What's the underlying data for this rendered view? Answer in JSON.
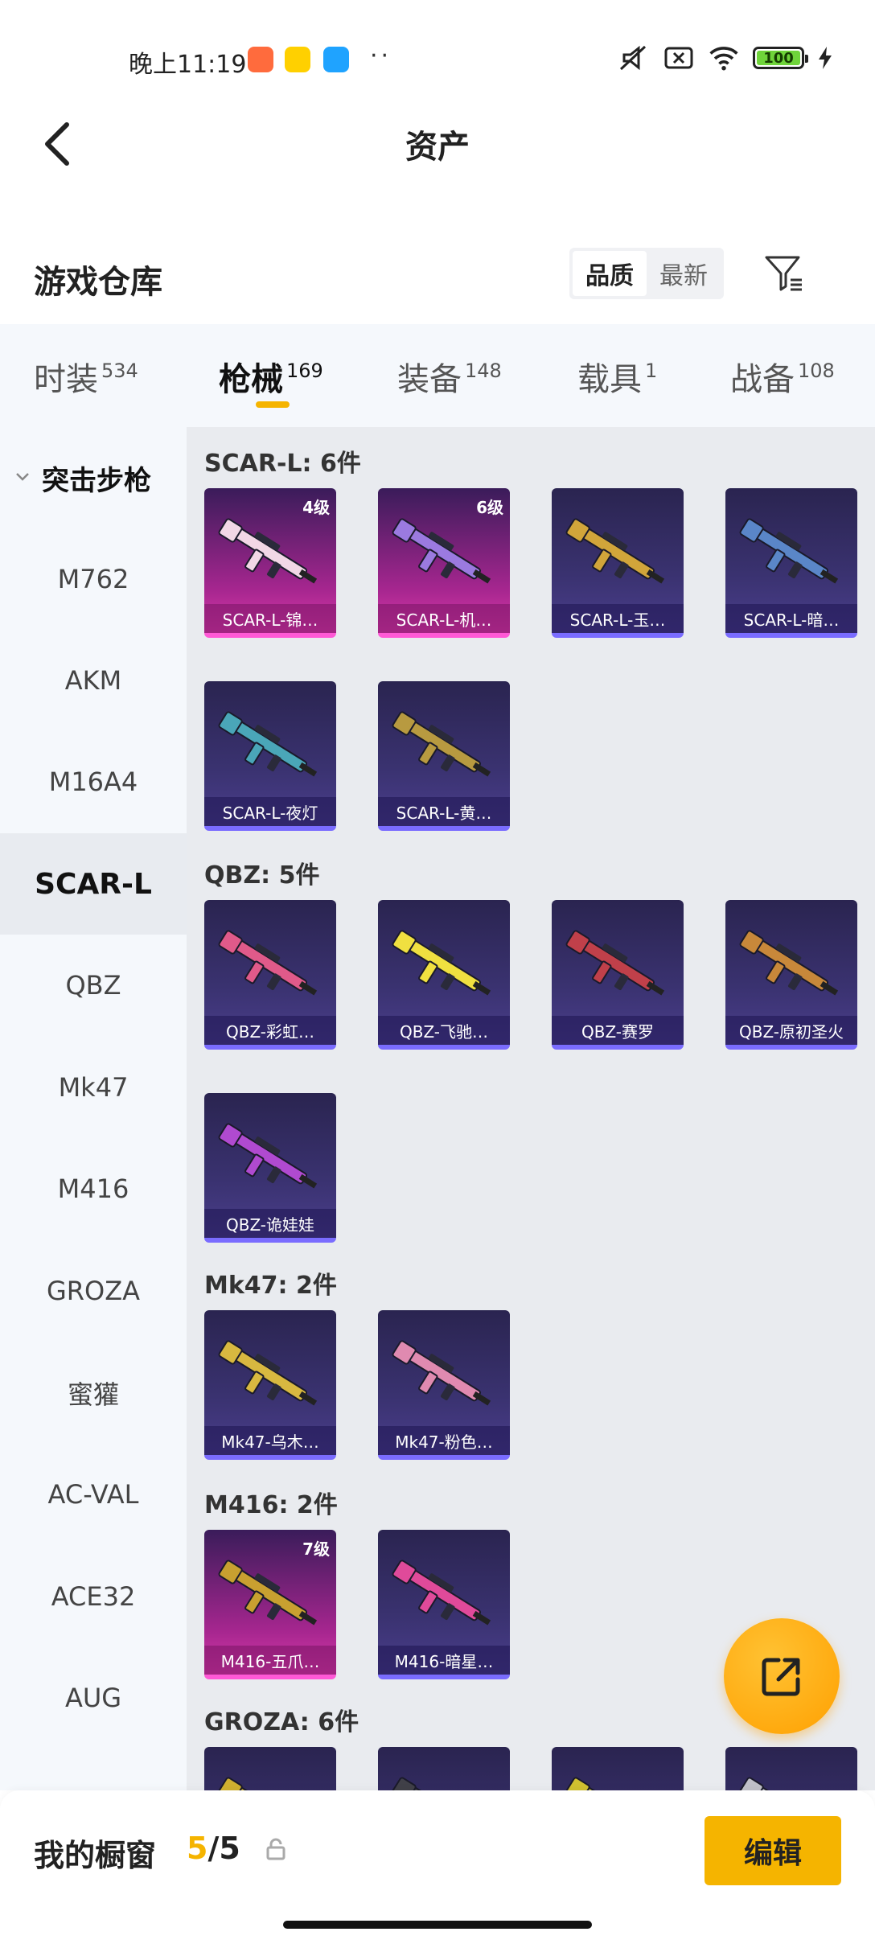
{
  "status_bar": {
    "time": "晚上11:19",
    "dots": "··",
    "battery": "100",
    "colors": {
      "app1": "#ff6b3d",
      "app2": "#ffd000",
      "app3": "#1fa3ff",
      "battery_fill": "#6fd43a"
    }
  },
  "header": {
    "title": "资产",
    "back_icon": "chevron-left-icon"
  },
  "warehouse": {
    "title": "游戏仓库",
    "sort_options": [
      "品质",
      "最新"
    ],
    "sort_selected": "品质",
    "filter_icon": "filter-icon"
  },
  "tabs": [
    {
      "label": "时装",
      "count": "534",
      "active": false
    },
    {
      "label": "枪械",
      "count": "169",
      "active": true
    },
    {
      "label": "装备",
      "count": "148",
      "active": false
    },
    {
      "label": "载具",
      "count": "1",
      "active": false
    },
    {
      "label": "战备",
      "count": "108",
      "active": false
    }
  ],
  "sidebar": {
    "group": "突击步枪",
    "items": [
      "M762",
      "AKM",
      "M16A4",
      "SCAR-L",
      "QBZ",
      "Mk47",
      "M416",
      "GROZA",
      "蜜獾",
      "AC-VAL",
      "ACE32",
      "AUG"
    ],
    "active": "SCAR-L"
  },
  "groups": [
    {
      "label": "SCAR-L: 6件",
      "items": [
        {
          "name": "SCAR-L-锦…",
          "level": "4级",
          "rarity": "purple",
          "color": "#f2d7e6"
        },
        {
          "name": "SCAR-L-机…",
          "level": "6级",
          "rarity": "purple",
          "color": "#9b7ae0"
        },
        {
          "name": "SCAR-L-玉…",
          "level": "",
          "rarity": "blue",
          "color": "#d1a53a"
        },
        {
          "name": "SCAR-L-暗…",
          "level": "",
          "rarity": "blue",
          "color": "#5a86c8"
        },
        {
          "name": "SCAR-L-夜灯",
          "level": "",
          "rarity": "blue",
          "color": "#4aa6b8"
        },
        {
          "name": "SCAR-L-黄…",
          "level": "",
          "rarity": "blue",
          "color": "#b89a40"
        }
      ]
    },
    {
      "label": "QBZ: 5件",
      "items": [
        {
          "name": "QBZ-彩虹…",
          "level": "",
          "rarity": "blue",
          "color": "#e05a8a"
        },
        {
          "name": "QBZ-飞驰…",
          "level": "",
          "rarity": "blue",
          "color": "#f0e040"
        },
        {
          "name": "QBZ-赛罗",
          "level": "",
          "rarity": "blue",
          "color": "#c0404a"
        },
        {
          "name": "QBZ-原初圣火",
          "level": "",
          "rarity": "blue",
          "color": "#c8883a"
        },
        {
          "name": "QBZ-诡娃娃",
          "level": "",
          "rarity": "blue",
          "color": "#b04ad0"
        }
      ]
    },
    {
      "label": "Mk47: 2件",
      "items": [
        {
          "name": "Mk47-乌木…",
          "level": "",
          "rarity": "blue",
          "color": "#d8b840"
        },
        {
          "name": "Mk47-粉色…",
          "level": "",
          "rarity": "blue",
          "color": "#e08ab0"
        }
      ]
    },
    {
      "label": "M416: 2件",
      "items": [
        {
          "name": "M416-五爪…",
          "level": "7级",
          "rarity": "purple",
          "color": "#c8a030"
        },
        {
          "name": "M416-暗星…",
          "level": "",
          "rarity": "blue",
          "color": "#e04a9a"
        }
      ]
    },
    {
      "label": "GROZA: 6件",
      "items": [
        {
          "name": "",
          "level": "",
          "rarity": "blue",
          "color": "#d0b030"
        },
        {
          "name": "",
          "level": "",
          "rarity": "blue",
          "color": "#404048"
        },
        {
          "name": "",
          "level": "",
          "rarity": "blue",
          "color": "#d0c030"
        },
        {
          "name": "",
          "level": "",
          "rarity": "blue",
          "color": "#c0c0c8"
        }
      ]
    }
  ],
  "fab": {
    "icon": "share-external-icon"
  },
  "bottom_bar": {
    "label": "我的橱窗",
    "current": "5",
    "separator": "/",
    "total": "5",
    "edit_label": "编辑",
    "lock_icon": "lock-icon"
  },
  "accent_color": "#f5b400"
}
